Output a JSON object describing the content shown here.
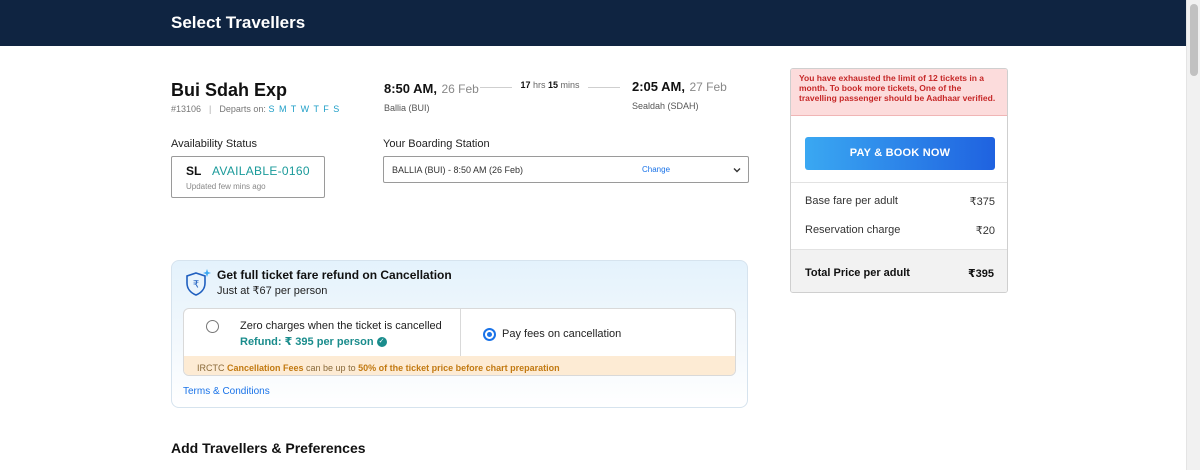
{
  "header": {
    "title": "Select Travellers"
  },
  "train": {
    "name": "Bui Sdah Exp",
    "number": "#13106",
    "departs_label": "Departs on:",
    "days": "S M T W T F S",
    "departure": {
      "time": "8:50 AM,",
      "date": "26 Feb",
      "station": "Ballia (BUI)"
    },
    "duration": {
      "hrs": "17",
      "hrs_unit": "hrs",
      "mins": "15",
      "mins_unit": "mins"
    },
    "arrival": {
      "time": "2:05 AM,",
      "date": "27 Feb",
      "station": "Sealdah (SDAH)"
    }
  },
  "availability": {
    "label": "Availability Status",
    "class_code": "SL",
    "status": "AVAILABLE-0160",
    "updated": "Updated few mins ago"
  },
  "boarding": {
    "label": "Your Boarding Station",
    "value": "BALLIA (BUI) - 8:50 AM (26 Feb)",
    "change_label": "Change"
  },
  "refund": {
    "title": "Get full ticket fare refund on Cancellation",
    "subtitle": "Just at ₹67 per person",
    "option1": {
      "text": "Zero charges when the ticket is cancelled",
      "refund": "Refund: ₹ 395 per person",
      "selected": false
    },
    "option2": {
      "text": "Pay fees on cancellation",
      "selected": true
    },
    "fee_note": {
      "prefix": "IRCTC ",
      "bold1": "Cancellation Fees",
      "middle": " can be up to ",
      "bold2": "50% of the ticket price before chart preparation"
    },
    "terms": "Terms & Conditions"
  },
  "travellers": {
    "heading": "Add Travellers & Preferences"
  },
  "payment": {
    "limit_message": "You have exhausted the limit of 12 tickets in a month. To book more tickets, One of the travelling passenger should be Aadhaar verified.",
    "book_button": "PAY & BOOK NOW",
    "fares": [
      {
        "label": "Base fare per adult",
        "amount": "₹375"
      },
      {
        "label": "Reservation charge",
        "amount": "₹20"
      }
    ],
    "total": {
      "label": "Total Price per adult",
      "amount": "₹395"
    }
  },
  "colors": {
    "header_bg": "#0f2441",
    "accent_blue": "#1a73e8",
    "available_teal": "#1a9a9a",
    "error_red": "#c62828"
  }
}
